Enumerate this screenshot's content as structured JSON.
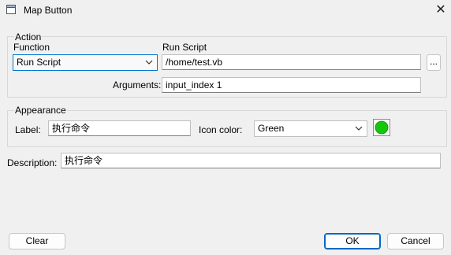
{
  "window": {
    "title": "Map Button",
    "close_glyph": "✕"
  },
  "action": {
    "group_title": "Action",
    "function_label": "Function",
    "function_value": "Run Script",
    "script_label": "Run Script",
    "script_value": "/home/test.vb",
    "browse_label": "...",
    "arguments_label": "Arguments:",
    "arguments_value": "input_index 1"
  },
  "appearance": {
    "group_title": "Appearance",
    "label_label": "Label:",
    "label_value": "执行命令",
    "icon_color_label": "Icon color:",
    "icon_color_value": "Green",
    "swatch_color": "#16c60c"
  },
  "description": {
    "label": "Description:",
    "value": "执行命令"
  },
  "buttons": {
    "clear": "Clear",
    "ok": "OK",
    "cancel": "Cancel"
  },
  "colors": {
    "accent": "#0078d4",
    "background": "#f0f0f0"
  }
}
